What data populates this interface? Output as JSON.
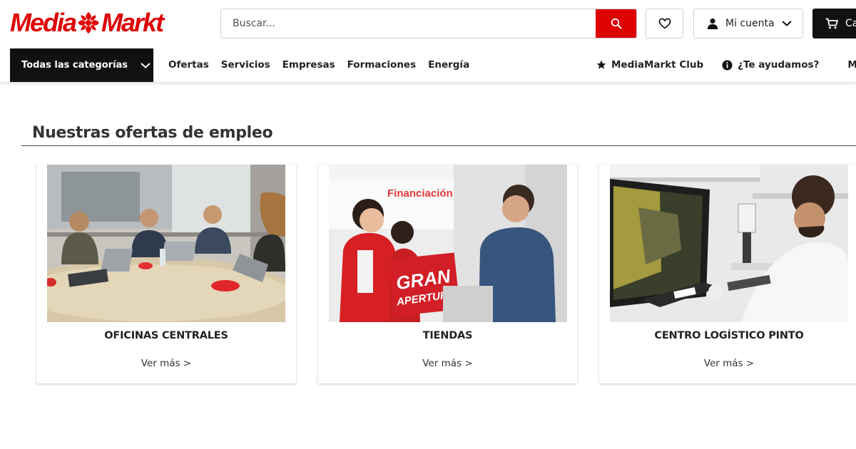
{
  "header": {
    "logo_text_1": "Media",
    "logo_text_2": "Markt",
    "search": {
      "placeholder": "Buscar...",
      "button_icon": "search-icon"
    },
    "wishlist_icon": "heart-icon",
    "account": {
      "label": "Mi cuenta",
      "icon": "user-icon"
    },
    "cart": {
      "label": "Ca",
      "icon": "cart-icon"
    }
  },
  "nav": {
    "all_categories": "Todas las categorías",
    "links": [
      "Ofertas",
      "Servicios",
      "Empresas",
      "Formaciones",
      "Energía"
    ],
    "club": "MediaMarkt Club",
    "help": "¿Te ayudamos?",
    "store": "Mi tienda"
  },
  "section": {
    "title": "Nuestras ofertas de empleo"
  },
  "cards": [
    {
      "title": "OFICINAS CENTRALES",
      "link": "Ver más >"
    },
    {
      "title": "TIENDAS",
      "link": "Ver más >",
      "banner_line1": "GRAN",
      "banner_line2": "APERTURA",
      "sign_text": "Financiación"
    },
    {
      "title": "CENTRO LOGÍSTICO PINTO",
      "link": "Ver más >"
    }
  ],
  "colors": {
    "brand_red": "#df0000",
    "dark": "#111111"
  }
}
